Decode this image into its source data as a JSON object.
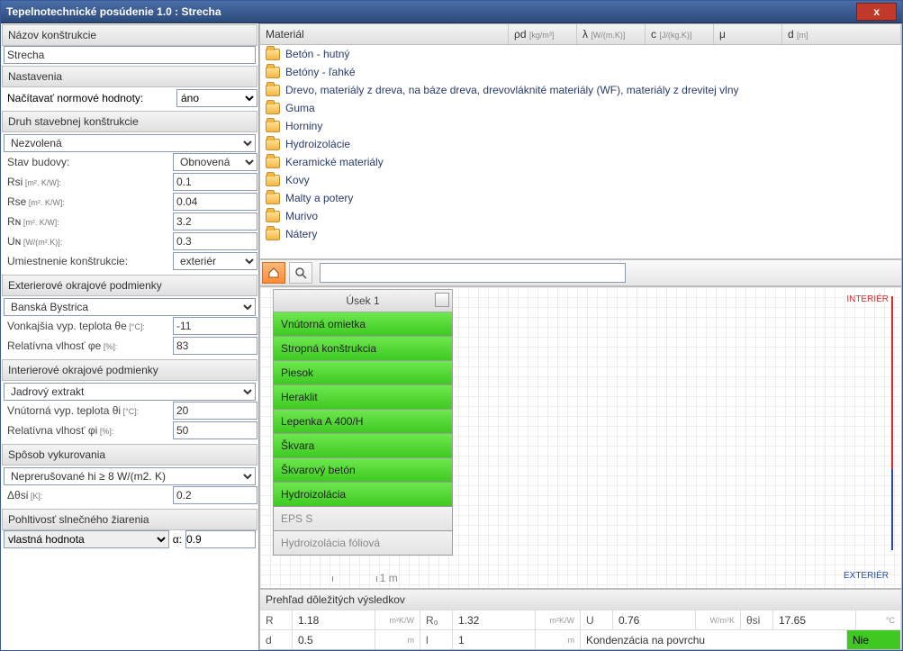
{
  "window": {
    "title": "Tepelnotechnické posúdenie 1.0 : Strecha",
    "close": "x"
  },
  "left": {
    "p_name": {
      "hdr": "Názov konštrukcie",
      "value": "Strecha"
    },
    "p_settings": {
      "hdr": "Nastavenia",
      "load_lbl": "Načítavať normové hodnoty:",
      "load_val": "áno"
    },
    "p_type": {
      "hdr": "Druh stavebnej konštrukcie",
      "sel": "Nezvolená",
      "state_lbl": "Stav budovy:",
      "state_val": "Obnovená",
      "rsi_lbl": "Rsi",
      "rsi_unit": " [m². K/W]:",
      "rsi_val": "0.1",
      "rse_lbl": "Rse",
      "rse_unit": " [m². K/W]:",
      "rse_val": "0.04",
      "rn_lbl": "Rɴ",
      "rn_unit": " [m². K/W]:",
      "rn_val": "3.2",
      "un_lbl": "Uɴ",
      "un_unit": " [W/(m².K)]:",
      "un_val": "0.3",
      "place_lbl": "Umiestnenie konštrukcie:",
      "place_val": "exteriér"
    },
    "p_ext": {
      "hdr": "Exterierové okrajové podmienky",
      "city": "Banská Bystrica",
      "te_lbl": "Vonkajšia vyp. teplota θe",
      "te_unit": " [°C]:",
      "te_val": "-11",
      "rh_lbl": "Relatívna vlhosť φe",
      "rh_unit": " [%]:",
      "rh_val": "83"
    },
    "p_int": {
      "hdr": "Interierové okrajové podmienky",
      "sel": "Jadrový extrakt",
      "ti_lbl": "Vnútorná vyp. teplota θi",
      "ti_unit": " [°C]:",
      "ti_val": "20",
      "rh_lbl": "Relatívna vlhosť φi",
      "rh_unit": " [%]:",
      "rh_val": "50"
    },
    "p_heat": {
      "hdr": "Spôsob vykurovania",
      "sel": "Neprerušované hi ≥ 8 W/(m2. K)",
      "dt_lbl": "Δθsi",
      "dt_unit": " [K]:",
      "dt_val": "0.2"
    },
    "p_solar": {
      "hdr": "Pohltivosť slnečného žiarenia",
      "sel": "vlastná hodnota",
      "alpha_lbl": "α:",
      "alpha_val": "0.9"
    }
  },
  "mat_cols": {
    "c1": "Materiál",
    "c2": "ρd",
    "u2": "[kg/m³]",
    "c3": "λ",
    "u3": "[W/(m.K)]",
    "c4": "c",
    "u4": "[J/(kg.K)]",
    "c5": "μ",
    "c6": "d",
    "u6": "[m]"
  },
  "materials": [
    "Betón - hutný",
    "Betóny - ľahké",
    "Drevo, materiály z dreva, na báze dreva, drevovláknité materiály (WF), materiály z drevitej vlny",
    "Guma",
    "Horniny",
    "Hydroizolácie",
    "Keramické materiály",
    "Kovy",
    "Malty a potery",
    "Murivo",
    "Nátery"
  ],
  "search_ph": "",
  "usek": {
    "title": "Úsek 1",
    "layers": [
      {
        "name": "Vnútorná omietka",
        "g": true
      },
      {
        "name": "Stropná konštrukcia",
        "g": true
      },
      {
        "name": "Piesok",
        "g": true
      },
      {
        "name": "Heraklit",
        "g": true
      },
      {
        "name": "Lepenka A 400/H",
        "g": true
      },
      {
        "name": "Škvara",
        "g": true
      },
      {
        "name": "Škvarový betón",
        "g": true
      },
      {
        "name": "Hydroizolácia",
        "g": true
      },
      {
        "name": "EPS S",
        "g": false
      },
      {
        "name": "Hydroizolácia fóliová",
        "g": false
      }
    ]
  },
  "canvas": {
    "interior": "INTERIÉR",
    "exterior": "EXTERIÉR",
    "scale": "1 m"
  },
  "results": {
    "hdr": "Prehľad dôležitých výsledkov",
    "r": {
      "l": "R",
      "v": "1.18",
      "u": "m²K/W"
    },
    "r0": {
      "l": "R₀",
      "v": "1.32",
      "u": "m²K/W"
    },
    "u": {
      "l": "U",
      "v": "0.76",
      "u": "W/m²K"
    },
    "tsi": {
      "l": "θsi",
      "v": "17.65",
      "u": "°C"
    },
    "d": {
      "l": "d",
      "v": "0.5",
      "u": "m"
    },
    "len": {
      "l": "l",
      "v": "1",
      "u": "m"
    },
    "cond_lbl": "Kondenzácia na povrchu",
    "cond_val": "Nie"
  }
}
